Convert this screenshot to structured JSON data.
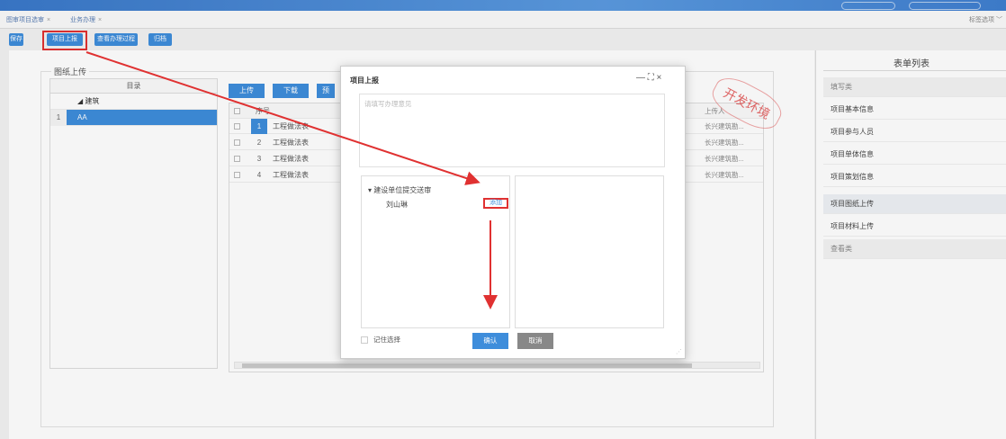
{
  "tabs": [
    {
      "label": "图审项目选审",
      "close": "×"
    },
    {
      "label": "业务办理",
      "close": "×"
    }
  ],
  "tab_options": "标签选项",
  "toolbar": {
    "buttons": [
      "保存",
      "项目上报",
      "查看办理过程",
      "归档"
    ]
  },
  "drawing_upload": {
    "legend": "图纸上传",
    "tree_header": "目录",
    "tree_items": [
      {
        "num": "",
        "label": "◢ 建筑"
      },
      {
        "num": "1",
        "label": "AA"
      }
    ],
    "actions": [
      "上传",
      "下载",
      "预"
    ],
    "grid_header_no": "序号",
    "grid_header_uploader": "上传人",
    "rows": [
      {
        "no": "1",
        "name": "工程做法表",
        "uploader": "长兴建筑勘..."
      },
      {
        "no": "2",
        "name": "工程做法表",
        "uploader": "长兴建筑勘..."
      },
      {
        "no": "3",
        "name": "工程做法表",
        "uploader": "长兴建筑勘..."
      },
      {
        "no": "4",
        "name": "工程做法表",
        "uploader": "长兴建筑勘..."
      }
    ]
  },
  "form_list": {
    "title": "表单列表",
    "items": [
      {
        "label": "填写类",
        "kind": "category"
      },
      {
        "label": "项目基本信息",
        "kind": "item"
      },
      {
        "label": "项目参与人员",
        "kind": "item"
      },
      {
        "label": "项目单体信息",
        "kind": "item"
      },
      {
        "label": "项目策划信息",
        "kind": "item"
      },
      {
        "label": "项目图纸上传",
        "kind": "active"
      },
      {
        "label": "项目材料上传",
        "kind": "item"
      },
      {
        "label": "查看类",
        "kind": "category"
      }
    ]
  },
  "dialog": {
    "title": "项目上报",
    "controls": "— ⛶ ×",
    "opinion_placeholder": "请填写办理意见",
    "tree_node": "▾ 建设单位提交送审",
    "person": "刘山琳",
    "add_label": "添加",
    "remember_label": "记住选择",
    "confirm": "确认",
    "cancel": "取消"
  },
  "stamp_text": "开发环境",
  "colors": {
    "primary": "#3e8ddb",
    "highlight": "#e03131",
    "cancel": "#888888"
  }
}
